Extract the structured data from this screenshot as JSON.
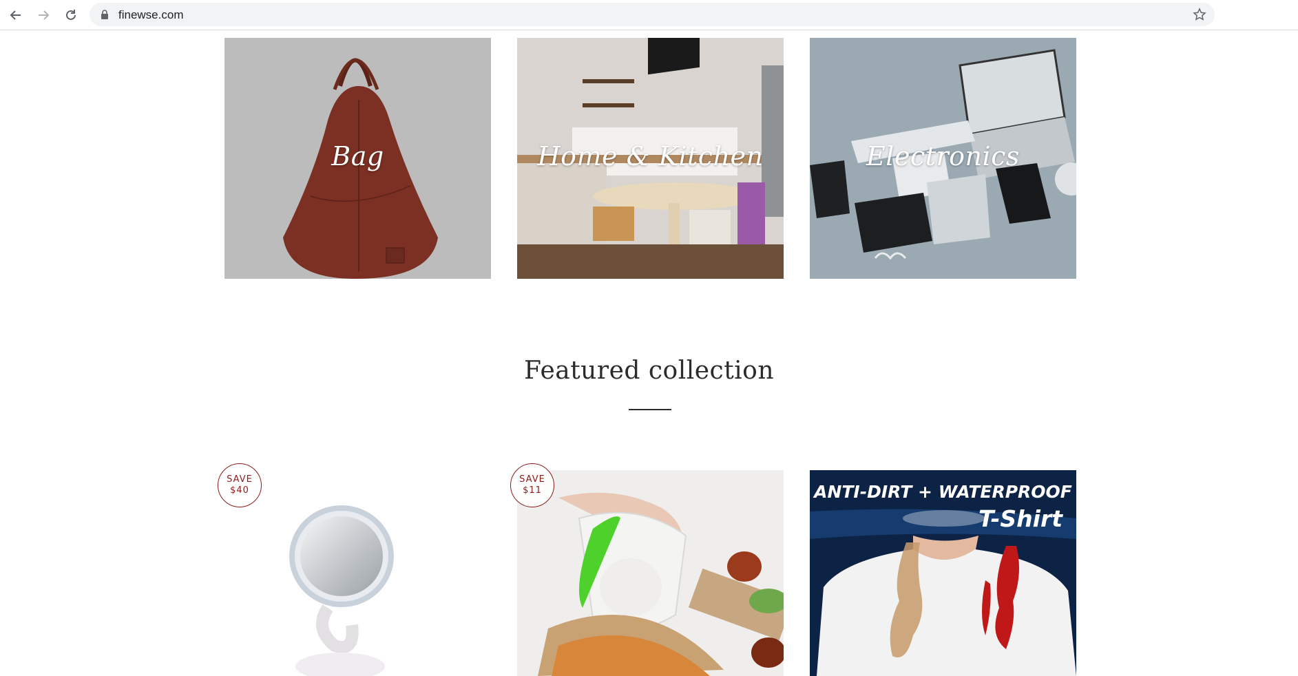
{
  "browser": {
    "url": "finewse.com",
    "icons": [
      "back-arrow-icon",
      "forward-arrow-icon",
      "reload-icon",
      "lock-icon",
      "star-icon"
    ]
  },
  "collections": [
    {
      "label": "Bag"
    },
    {
      "label": "Home & Kitchen"
    },
    {
      "label": "Electronics"
    }
  ],
  "featured": {
    "title": "Featured collection"
  },
  "products": [
    {
      "badge_line1": "SAVE",
      "badge_line2": "$40"
    },
    {
      "badge_line1": "SAVE",
      "badge_line2": "$11"
    },
    {
      "banner_line1": "ANTI-DIRT + WATERPROOF",
      "banner_line2": "T-Shirt"
    }
  ],
  "colors": {
    "badge": "#8a1c1c",
    "address_bar": "#f1f3f4",
    "tshirt_banner": "#0d2346"
  }
}
